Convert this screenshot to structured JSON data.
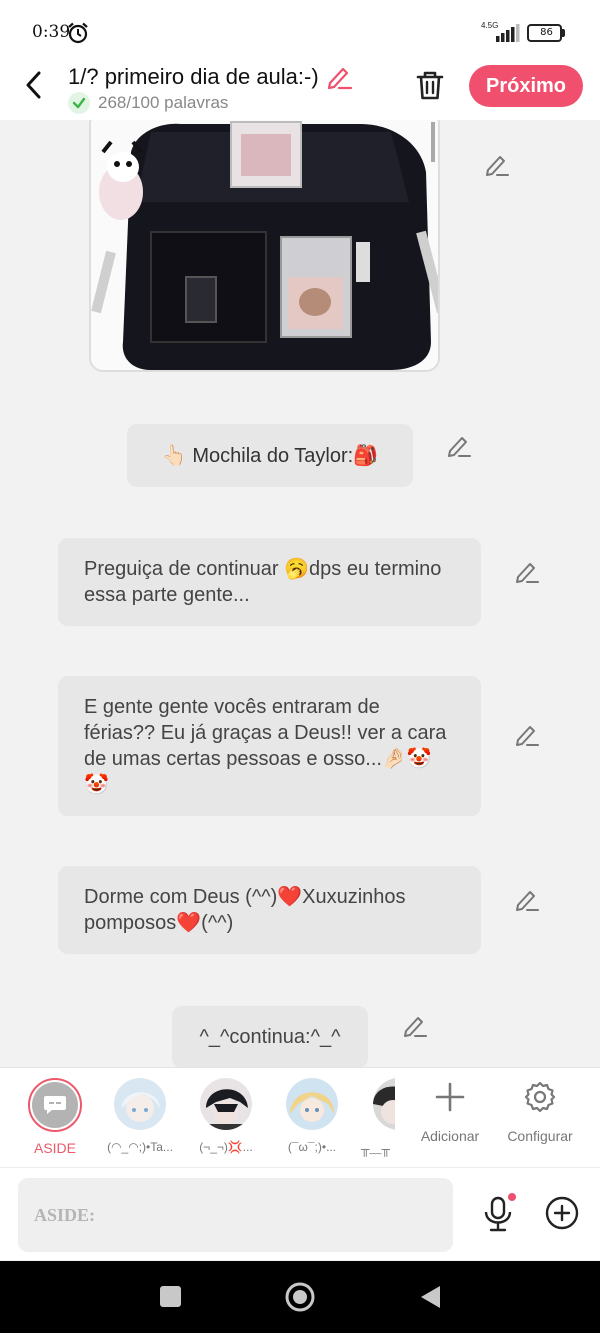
{
  "status_bar": {
    "time": "0:39",
    "network": "4.5G",
    "battery": "86",
    "icons": [
      "alarm-icon",
      "signal-icon",
      "battery-icon"
    ]
  },
  "header": {
    "title": "1/? primeiro dia de aula:-)",
    "word_count": "268/100 palavras",
    "next_label": "Próximo",
    "accent_color": "#f0506e",
    "icons": [
      "back-icon",
      "edit-icon",
      "check-icon",
      "trash-icon"
    ]
  },
  "messages": {
    "caption": "👆🏻 Mochila do Taylor:🎒",
    "msg1": "Preguiça de continuar 🥱dps eu termino essa parte gente...",
    "msg2": "E gente gente vocês entraram de férias??  Eu já graças a Deus!! ver a cara de umas certas pessoas e osso...🤌🏻🤡🤡",
    "msg3": "Dorme com Deus (^^)❤️Xuxuzinhos pomposos❤️(^^)",
    "msg4": "^_^continua:^_^"
  },
  "characters": [
    {
      "name": "ASIDE",
      "selected": true
    },
    {
      "name": "(◠_◠;)•Ta..."
    },
    {
      "name": "(¬_¬)💢..."
    },
    {
      "name": "(¯ω¯;)•..."
    },
    {
      "name": "╥﹏╥"
    }
  ],
  "tools": {
    "add_label": "Adicionar",
    "settings_label": "Configurar"
  },
  "input": {
    "placeholder": "ASIDE:"
  }
}
